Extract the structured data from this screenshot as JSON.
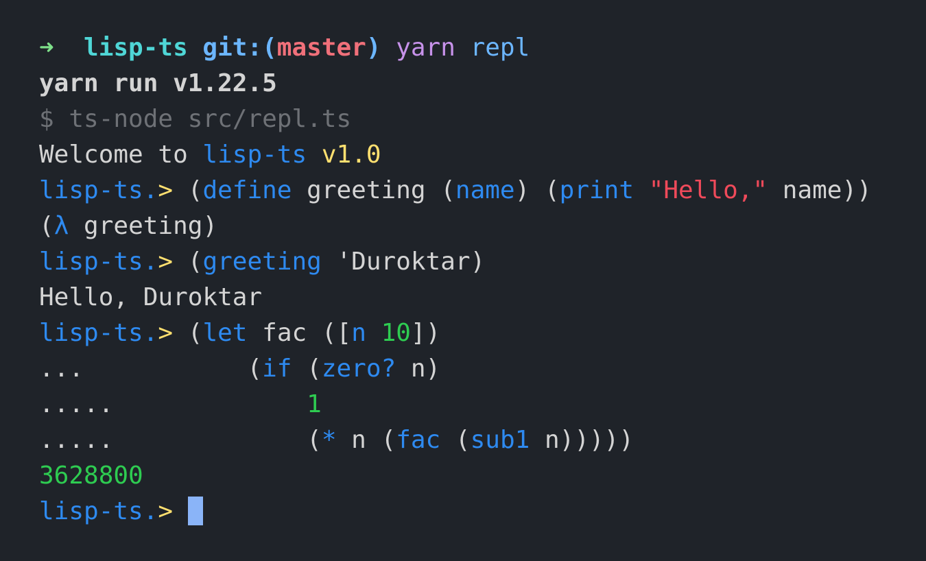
{
  "window": {
    "background": "#1f2329",
    "cursor_color": "#8ab4f8"
  },
  "lines": [
    {
      "kind": "shell-prompt",
      "segments": [
        {
          "text": "➜  ",
          "color": "arrow"
        },
        {
          "text": "lisp-ts ",
          "color": "cyan"
        },
        {
          "text": "git:(",
          "color": "git"
        },
        {
          "text": "master",
          "color": "branch"
        },
        {
          "text": ") ",
          "color": "git"
        },
        {
          "text": "yarn ",
          "color": "purple"
        },
        {
          "text": "repl",
          "color": "lblue"
        }
      ]
    },
    {
      "kind": "output",
      "segments": [
        {
          "text": "yarn run v1.22.5",
          "color": "bold"
        }
      ]
    },
    {
      "kind": "output",
      "segments": [
        {
          "text": "$ ts-node src/repl.ts",
          "color": "gray"
        }
      ]
    },
    {
      "kind": "output",
      "segments": [
        {
          "text": "Welcome to ",
          "color": "text"
        },
        {
          "text": "lisp-ts",
          "color": "blue"
        },
        {
          "text": " v1.0",
          "color": "yellow"
        }
      ]
    },
    {
      "kind": "repl-input",
      "segments": [
        {
          "text": "lisp-ts.",
          "color": "blue"
        },
        {
          "text": "> ",
          "color": "yellow"
        },
        {
          "text": "(",
          "color": "text"
        },
        {
          "text": "define",
          "color": "blue"
        },
        {
          "text": " greeting (",
          "color": "text"
        },
        {
          "text": "name",
          "color": "blue"
        },
        {
          "text": ") (",
          "color": "text"
        },
        {
          "text": "print",
          "color": "blue"
        },
        {
          "text": " ",
          "color": "text"
        },
        {
          "text": "\"Hello,\"",
          "color": "red"
        },
        {
          "text": " name))",
          "color": "text"
        }
      ]
    },
    {
      "kind": "output",
      "segments": [
        {
          "text": "(",
          "color": "text"
        },
        {
          "text": "λ",
          "color": "blue"
        },
        {
          "text": " greeting)",
          "color": "text"
        }
      ]
    },
    {
      "kind": "repl-input",
      "segments": [
        {
          "text": "lisp-ts.",
          "color": "blue"
        },
        {
          "text": "> ",
          "color": "yellow"
        },
        {
          "text": "(",
          "color": "text"
        },
        {
          "text": "greeting",
          "color": "blue"
        },
        {
          "text": " 'Duroktar)",
          "color": "text"
        }
      ]
    },
    {
      "kind": "output",
      "segments": [
        {
          "text": "Hello, Duroktar",
          "color": "text"
        }
      ]
    },
    {
      "kind": "repl-input",
      "segments": [
        {
          "text": "lisp-ts.",
          "color": "blue"
        },
        {
          "text": "> ",
          "color": "yellow"
        },
        {
          "text": "(",
          "color": "text"
        },
        {
          "text": "let",
          "color": "blue"
        },
        {
          "text": " fac ([",
          "color": "text"
        },
        {
          "text": "n",
          "color": "blue"
        },
        {
          "text": " ",
          "color": "text"
        },
        {
          "text": "10",
          "color": "green"
        },
        {
          "text": "])",
          "color": "text"
        }
      ]
    },
    {
      "kind": "continuation",
      "segments": [
        {
          "text": "...           (",
          "color": "text"
        },
        {
          "text": "if",
          "color": "blue"
        },
        {
          "text": " (",
          "color": "text"
        },
        {
          "text": "zero?",
          "color": "blue"
        },
        {
          "text": " n)",
          "color": "text"
        }
      ]
    },
    {
      "kind": "continuation",
      "segments": [
        {
          "text": ".....             ",
          "color": "text"
        },
        {
          "text": "1",
          "color": "green"
        }
      ]
    },
    {
      "kind": "continuation",
      "segments": [
        {
          "text": ".....             (",
          "color": "text"
        },
        {
          "text": "*",
          "color": "blue"
        },
        {
          "text": " n (",
          "color": "text"
        },
        {
          "text": "fac",
          "color": "blue"
        },
        {
          "text": " (",
          "color": "text"
        },
        {
          "text": "sub1",
          "color": "blue"
        },
        {
          "text": " n)))))",
          "color": "text"
        }
      ]
    },
    {
      "kind": "output",
      "segments": [
        {
          "text": "3628800",
          "color": "green"
        }
      ]
    },
    {
      "kind": "repl-prompt-active",
      "segments": [
        {
          "text": "lisp-ts.",
          "color": "blue"
        },
        {
          "text": "> ",
          "color": "yellow"
        }
      ],
      "cursor": true
    }
  ]
}
